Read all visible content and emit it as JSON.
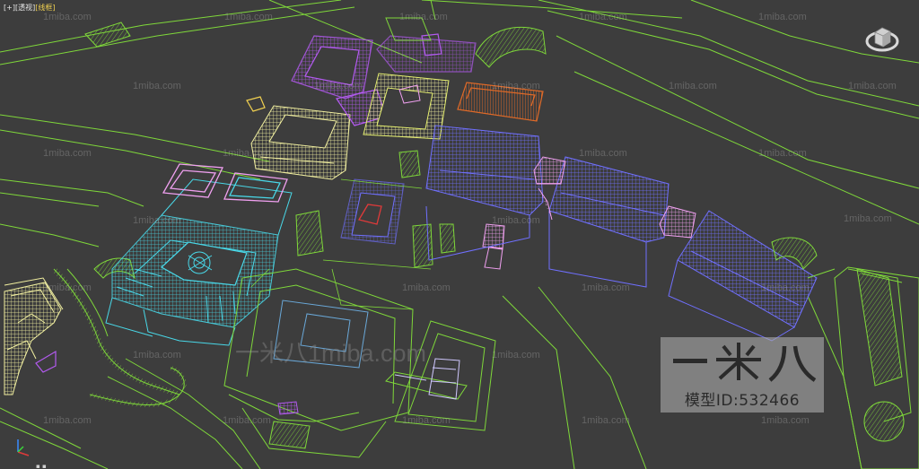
{
  "viewport": {
    "label_plus": "[+]",
    "label_view": "[透视]",
    "label_shading": "[线框]"
  },
  "watermarks": {
    "small": "1miba.com",
    "large": "一米八1miba.com"
  },
  "brand": {
    "logo_text": "一米八",
    "model_id": "模型ID:532466"
  },
  "bottom_marks": "▪ ▪",
  "colors": {
    "background": "#3d3d3d",
    "green_wire": "#7fd83a",
    "cyan": "#49d8e8",
    "yellow": "#f2f0a0",
    "purple": "#b35af0",
    "blue": "#7070ff",
    "pink": "#f0a0f0",
    "orange": "#e06a28",
    "red": "#e03a3a"
  },
  "icons": [
    "viewcube-icon",
    "axis-tripod-icon"
  ]
}
